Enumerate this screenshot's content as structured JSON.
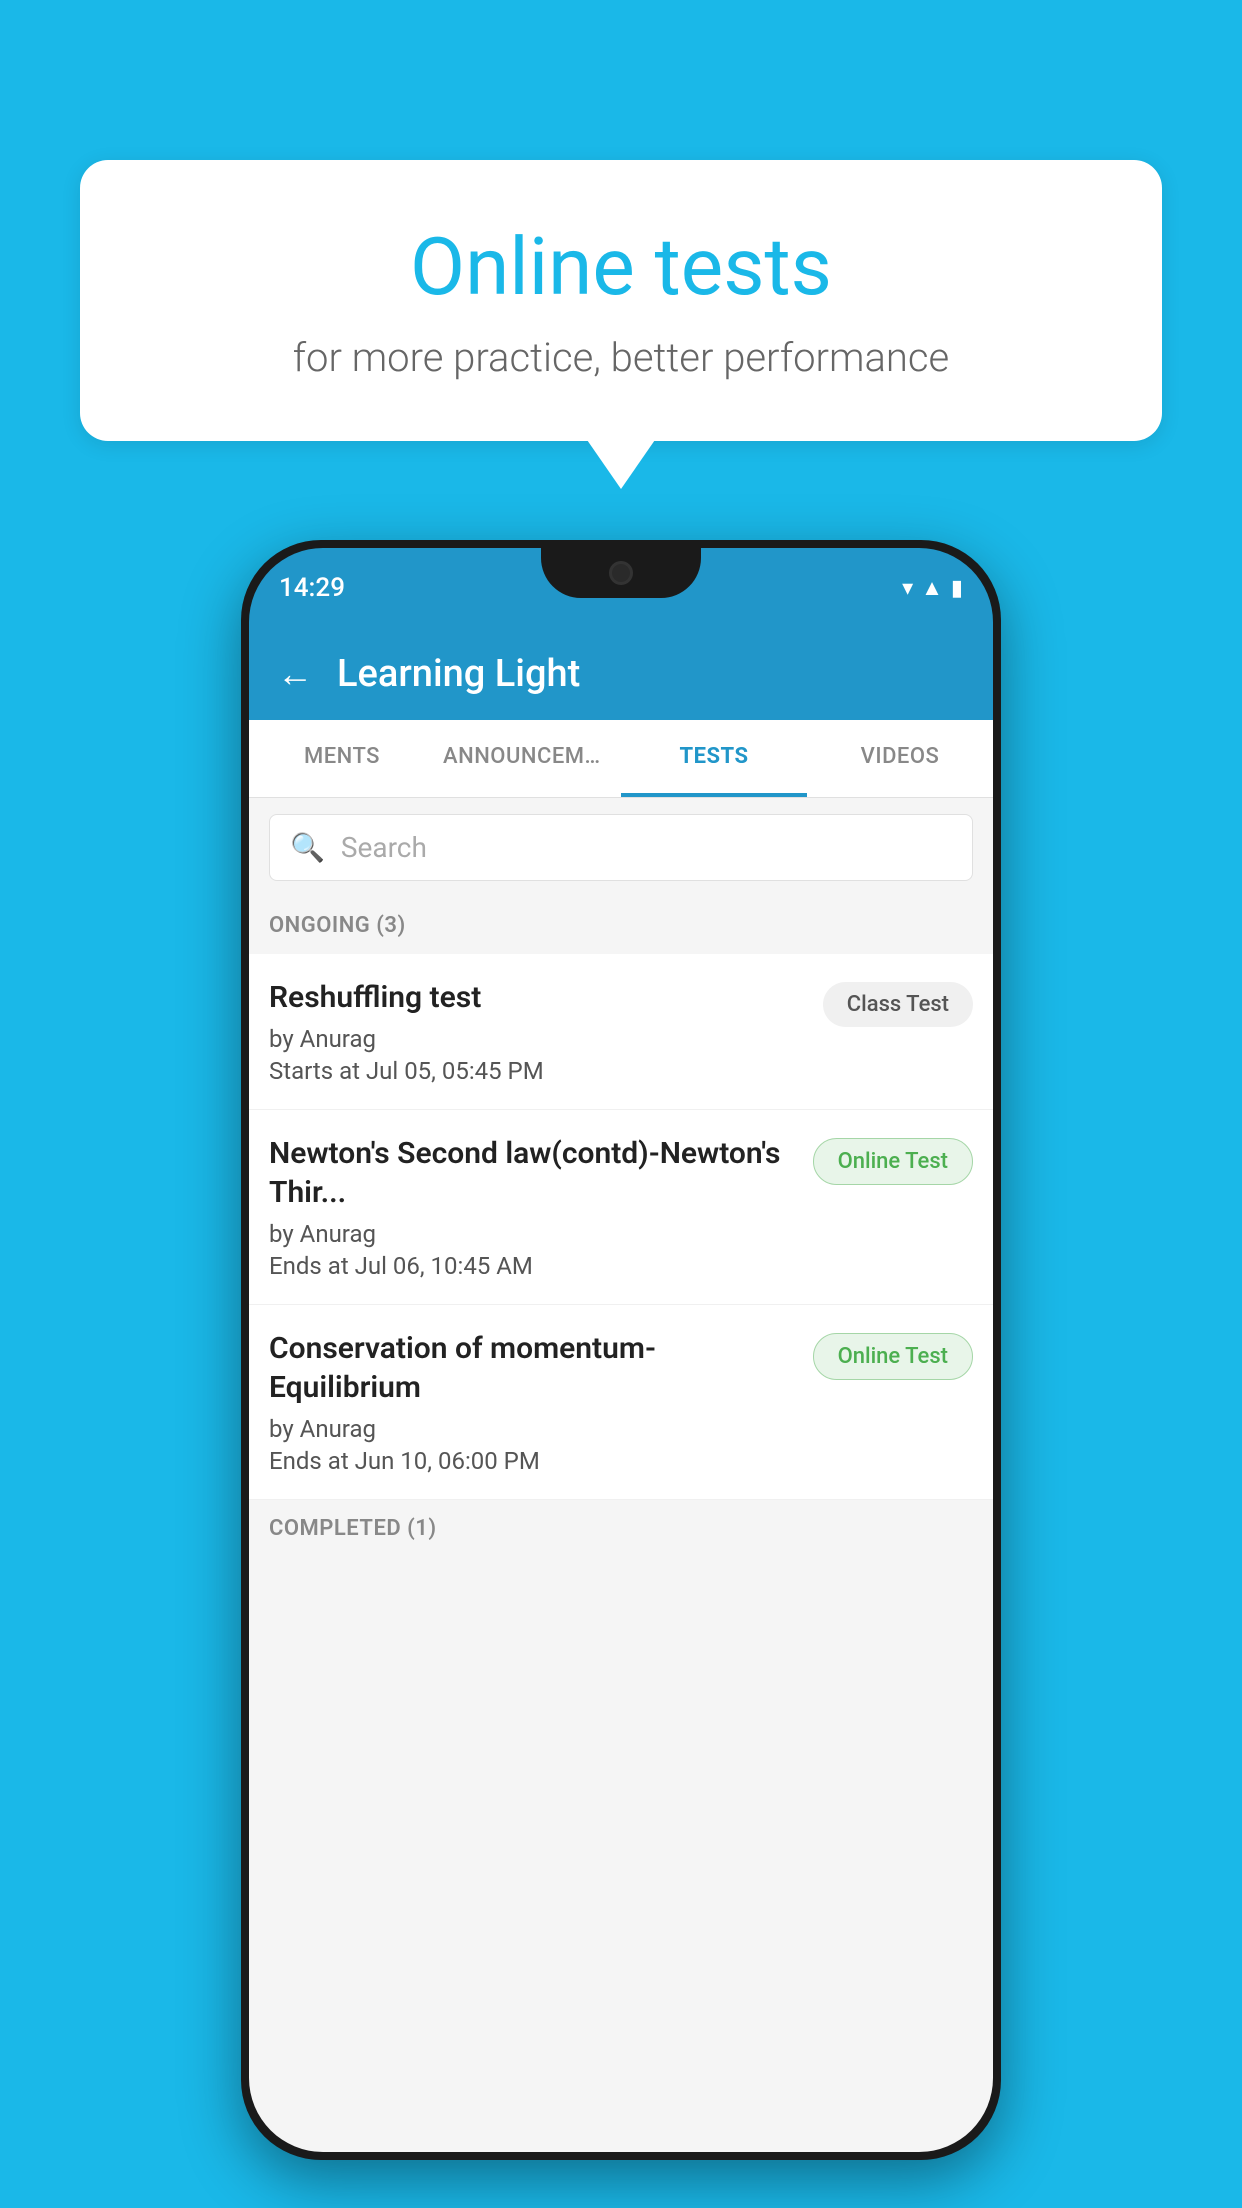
{
  "background_color": "#1ab8e8",
  "bubble": {
    "title": "Online tests",
    "subtitle": "for more practice, better performance"
  },
  "phone": {
    "status_bar": {
      "time": "14:29",
      "icons": [
        "wifi",
        "signal",
        "battery"
      ]
    },
    "header": {
      "title": "Learning Light",
      "back_label": "←"
    },
    "tabs": [
      {
        "label": "MENTS",
        "active": false
      },
      {
        "label": "ANNOUNCEMENTS",
        "active": false
      },
      {
        "label": "TESTS",
        "active": true
      },
      {
        "label": "VIDEOS",
        "active": false
      }
    ],
    "search": {
      "placeholder": "Search"
    },
    "section_ongoing": {
      "label": "ONGOING (3)"
    },
    "tests": [
      {
        "title": "Reshuffling test",
        "author": "by Anurag",
        "time": "Starts at  Jul 05, 05:45 PM",
        "badge": "Class Test",
        "badge_type": "class"
      },
      {
        "title": "Newton's Second law(contd)-Newton's Thir...",
        "author": "by Anurag",
        "time": "Ends at  Jul 06, 10:45 AM",
        "badge": "Online Test",
        "badge_type": "online"
      },
      {
        "title": "Conservation of momentum-Equilibrium",
        "author": "by Anurag",
        "time": "Ends at  Jun 10, 06:00 PM",
        "badge": "Online Test",
        "badge_type": "online"
      }
    ],
    "section_completed": {
      "label": "COMPLETED (1)"
    }
  }
}
